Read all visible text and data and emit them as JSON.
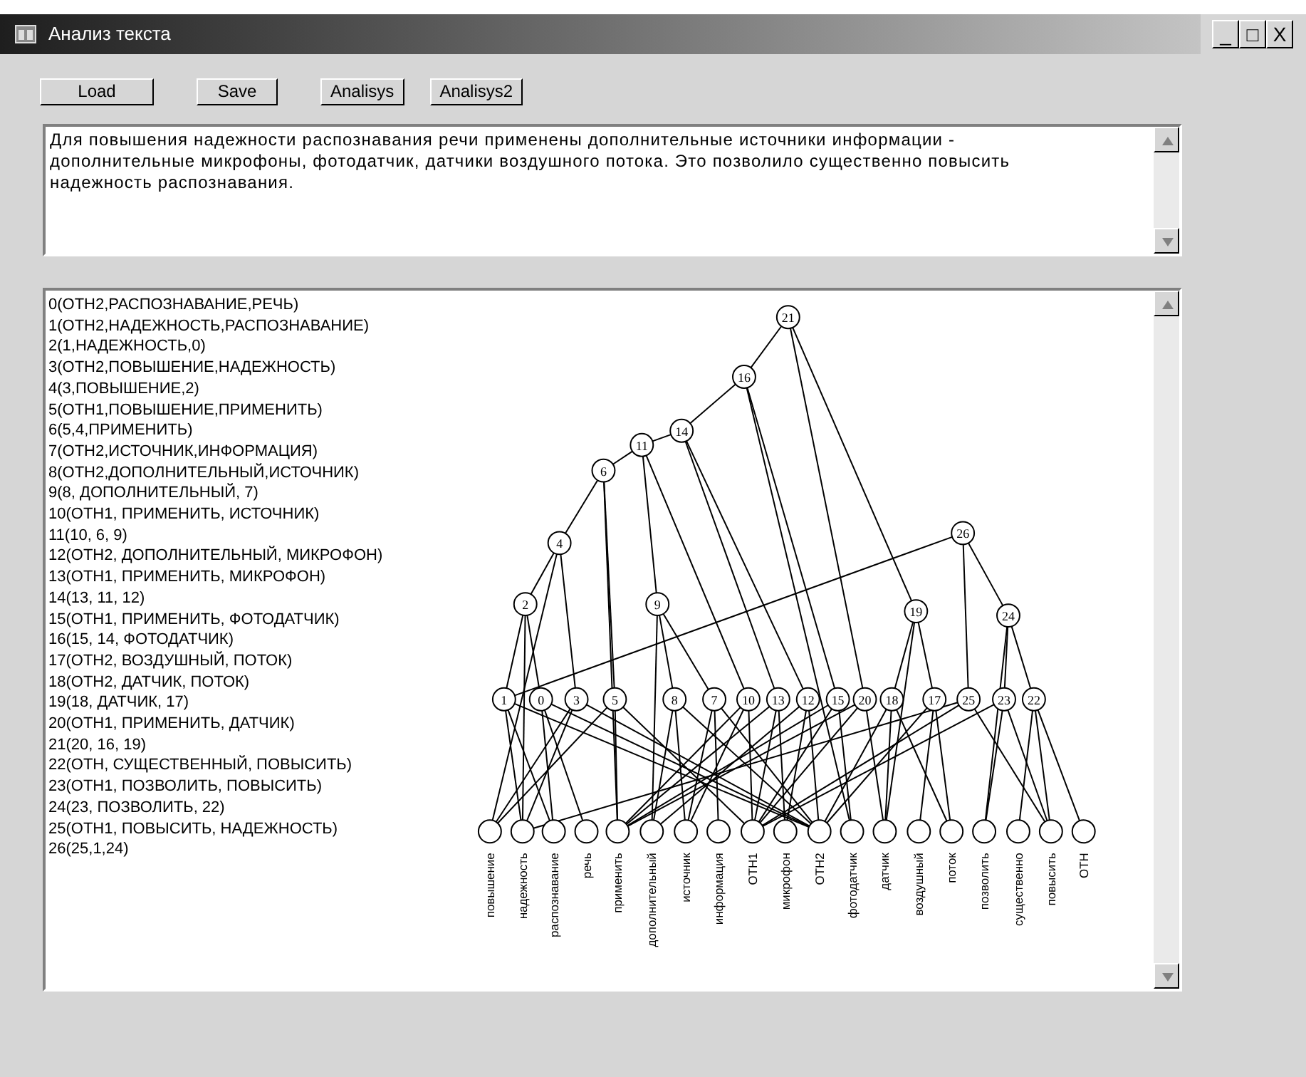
{
  "window": {
    "title": "Анализ текста",
    "controls": [
      "_",
      "□",
      "X"
    ]
  },
  "buttons": [
    "Load",
    "Save",
    "Analisys",
    "Analisys2"
  ],
  "text_input": {
    "value": "Для повышения надежности распознавания речи применены дополнительные источники информации - дополнительные микрофоны, фотодатчик, датчики воздушного потока. Это позволило существенно повысить надежность распознавания."
  },
  "relations": [
    "0(ОТН2,РАСПОЗНАВАНИЕ,РЕЧЬ)",
    "1(ОТН2,НАДЕЖНОСТЬ,РАСПОЗНАВАНИЕ)",
    "2(1,НАДЕЖНОСТЬ,0)",
    "3(ОТН2,ПОВЫШЕНИЕ,НАДЕЖНОСТЬ)",
    "4(3,ПОВЫШЕНИЕ,2)",
    "5(ОТН1,ПОВЫШЕНИЕ,ПРИМЕНИТЬ)",
    "6(5,4,ПРИМЕНИТЬ)",
    "7(ОТН2,ИСТОЧНИК,ИНФОРМАЦИЯ)",
    "8(ОТН2,ДОПОЛНИТЕЛЬНЫЙ,ИСТОЧНИК)",
    "9(8, ДОПОЛНИТЕЛЬНЫЙ, 7)",
    "10(ОТН1, ПРИМЕНИТЬ, ИСТОЧНИК)",
    "11(10, 6, 9)",
    "12(ОТН2, ДОПОЛНИТЕЛЬНЫЙ, МИКРОФОН)",
    "13(ОТН1, ПРИМЕНИТЬ, МИКРОФОН)",
    "14(13, 11, 12)",
    "15(ОТН1, ПРИМЕНИТЬ, ФОТОДАТЧИК)",
    "16(15, 14, ФОТОДАТЧИК)",
    "17(ОТН2, ВОЗДУШНЫЙ, ПОТОК)",
    "18(ОТН2, ДАТЧИК, ПОТОК)",
    "19(18, ДАТЧИК, 17)",
    "20(ОТН1, ПРИМЕНИТЬ, ДАТЧИК)",
    "21(20, 16, 19)",
    "22(ОТН, СУЩЕСТВЕННЫЙ, ПОВЫСИТЬ)",
    "23(ОТН1, ПОЗВОЛИТЬ, ПОВЫСИТЬ)",
    "24(23, ПОЗВОЛИТЬ, 22)",
    "25(ОТН1, ПОВЫСИТЬ, НАДЕЖНОСТЬ)",
    "26(25,1,24)"
  ],
  "graph": {
    "leaves": [
      "повышение",
      "надежность",
      "распознавание",
      "речь",
      "применить",
      "дополнительный",
      "источник",
      "информация",
      "ОТН1",
      "микрофон",
      "ОТН2",
      "фотодатчик",
      "датчик",
      "воздушный",
      "поток",
      "позволить",
      "существенно",
      "повысить",
      "ОТН"
    ],
    "nodes": [
      "21",
      "16",
      "14",
      "11",
      "6",
      "4",
      "26",
      "2",
      "9",
      "19",
      "24",
      "1",
      "0",
      "3",
      "5",
      "8",
      "7",
      "10",
      "13",
      "12",
      "15",
      "20",
      "18",
      "17",
      "25",
      "23",
      "22"
    ]
  }
}
